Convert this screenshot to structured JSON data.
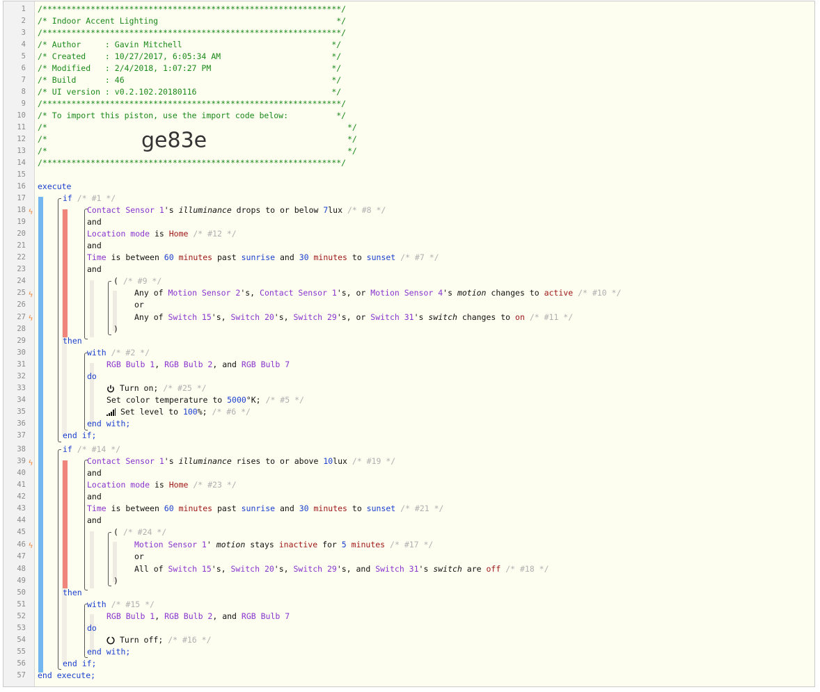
{
  "piston": {
    "name": "Indoor Accent Lighting",
    "author": "Gavin Mitchell",
    "created": "10/27/2017, 6:05:34 AM",
    "modified": "2/4/2018, 1:07:27 PM",
    "build": "46",
    "ui_version": "v0.2.102.20180116",
    "import_code": "ge83e"
  },
  "header_lines": {
    "stars": "/**************************************************************/",
    "title": "/* Indoor Accent Lighting                                     */",
    "author": "/* Author     : Gavin Mitchell                               */",
    "created": "/* Created    : 10/27/2017, 6:05:34 AM                       */",
    "modified": "/* Modified   : 2/4/2018, 1:07:27 PM                         */",
    "build": "/* Build      : 46                                           */",
    "ui": "/* UI version : v0.2.102.20180116                            */",
    "import": "/* To import this piston, use the import code below:          */",
    "blank_open": "/*",
    "blank_close": "*/"
  },
  "keywords": {
    "execute": "execute",
    "end_execute": "end execute;",
    "if": "if",
    "then": "then",
    "with": "with",
    "do": "do",
    "end_with": "end with;",
    "end_if": "end if;",
    "and": "and",
    "or": "or",
    "open_paren": "(",
    "close_paren": ")"
  },
  "comments": {
    "c1": "/* #1 */",
    "c8": "/* #8 */",
    "c12": "/* #12 */",
    "c7": "/* #7 */",
    "c9": "/* #9 */",
    "c10": "/* #10 */",
    "c11": "/* #11 */",
    "c2": "/* #2 */",
    "c25": "/* #25 */",
    "c5": "/* #5 */",
    "c6": "/* #6 */",
    "c14": "/* #14 */",
    "c19": "/* #19 */",
    "c23": "/* #23 */",
    "c21": "/* #21 */",
    "c24": "/* #24 */",
    "c17": "/* #17 */",
    "c18": "/* #18 */",
    "c15": "/* #15 */",
    "c16": "/* #16 */"
  },
  "devices": {
    "contact1": "Contact Sensor 1",
    "motion1": "Motion Sensor 1",
    "motion2": "Motion Sensor 2",
    "motion4": "Motion Sensor 4",
    "switch15": "Switch 15",
    "switch20": "Switch 20",
    "switch29": "Switch 29",
    "switch31": "Switch 31",
    "bulb1": "RGB Bulb 1",
    "bulb2": "RGB Bulb 2",
    "bulb7": "RGB Bulb 7",
    "location_mode": "Location mode",
    "time": "Time"
  },
  "attributes": {
    "illuminance": "illuminance",
    "motion": "motion",
    "switch": "switch"
  },
  "text": {
    "apos_s": "'s",
    "apos": "'",
    "drops": " drops to or below ",
    "rises": " rises to or above ",
    "lux": "lux",
    "is": " is ",
    "is_between": " is between ",
    "minutes": "minutes",
    "past": " past ",
    "and_sp": " and ",
    "to_sp": " to ",
    "any_of": "Any of ",
    "all_of": "All of ",
    "comma_sp": ", ",
    "s_comma": "'s, ",
    "s_or": "'s, or ",
    "s_and": "'s, and ",
    "changes_to": " changes to ",
    "stays": " stays ",
    "for_sp": " for ",
    "are": " are ",
    "bulb_sep": ", ",
    "bulb_and": ", and ",
    "turn_on": "Turn on;",
    "turn_off": "Turn off;",
    "set_color": "Set color temperature to ",
    "kelvin": "°K;",
    "set_level": "Set level to ",
    "pct": "%;"
  },
  "values": {
    "lux7": "7",
    "lux10": "10",
    "home": "Home",
    "sixty": "60",
    "thirty": "30",
    "five": "5",
    "sunrise": "sunrise",
    "sunset": "sunset",
    "active": "active",
    "inactive": "inactive",
    "on": "on",
    "off": "off",
    "color_temp": "5000",
    "level": "100"
  },
  "line_numbers": [
    "1",
    "2",
    "3",
    "4",
    "5",
    "6",
    "7",
    "8",
    "9",
    "10",
    "11",
    "12",
    "13",
    "14",
    "15",
    "16",
    "17",
    "18",
    "19",
    "20",
    "21",
    "22",
    "23",
    "24",
    "25",
    "26",
    "27",
    "28",
    "29",
    "30",
    "31",
    "32",
    "33",
    "34",
    "35",
    "36",
    "37",
    "38",
    "39",
    "40",
    "41",
    "42",
    "43",
    "44",
    "45",
    "46",
    "47",
    "48",
    "49",
    "50",
    "51",
    "52",
    "53",
    "54",
    "55",
    "56",
    "57"
  ],
  "colors": {
    "comment_green": "#1a8a1a",
    "keyword_blue": "#1a3fcf",
    "device_purple": "#8a34cf",
    "value_red": "#a01818",
    "if_bar": "#74b6f0",
    "condition_bar": "#f0857c",
    "trigger_bolt": "#f08a3c"
  }
}
